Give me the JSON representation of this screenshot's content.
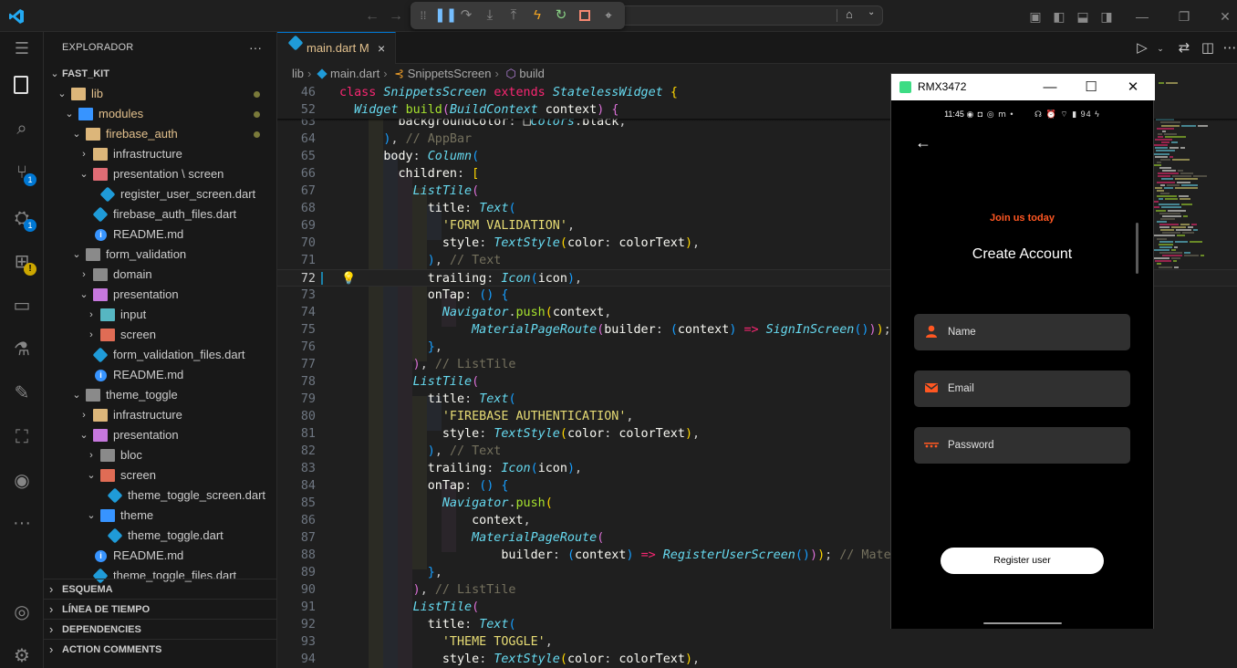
{
  "colors": {
    "accent": "#0078d4",
    "editor_bg": "#1f1f1f",
    "sidebar_bg": "#181818",
    "brand_orange": "#ff5722",
    "modified": "#e2c08d"
  },
  "titlebar": {
    "nav_back": "←",
    "nav_forward": "→",
    "debug_icons": [
      "drag-handle-icon",
      "pause-icon",
      "restart-icon",
      "step-over-icon",
      "step-into-icon",
      "hot-reload-icon",
      "hot-restart-icon",
      "stop-icon",
      "inspect-icon"
    ]
  },
  "activity": {
    "source_control_badge": "1",
    "debug_badge": "1"
  },
  "sidebar": {
    "title": "EXPLORADOR",
    "more": "···",
    "tree": [
      {
        "label": "FAST_KIT",
        "depth": 0,
        "kind": "root",
        "expanded": true
      },
      {
        "label": "lib",
        "depth": 1,
        "kind": "folder",
        "expanded": true,
        "color": "#dcb67a",
        "modified": true
      },
      {
        "label": "modules",
        "depth": 2,
        "kind": "folder",
        "expanded": true,
        "color": "#3794ff",
        "modified": true
      },
      {
        "label": "firebase_auth",
        "depth": 3,
        "kind": "folder",
        "expanded": true,
        "color": "#dcb67a",
        "modified": true
      },
      {
        "label": "infrastructure",
        "depth": 4,
        "kind": "folder",
        "expanded": false,
        "color": "#dcb67a"
      },
      {
        "label": "presentation \\ screen",
        "depth": 4,
        "kind": "folder",
        "expanded": true,
        "color": "#e06c75"
      },
      {
        "label": "register_user_screen.dart",
        "depth": 5,
        "kind": "dart"
      },
      {
        "label": "firebase_auth_files.dart",
        "depth": 4,
        "kind": "dart"
      },
      {
        "label": "README.md",
        "depth": 4,
        "kind": "info"
      },
      {
        "label": "form_validation",
        "depth": 3,
        "kind": "folder",
        "expanded": true,
        "color": "#8a8a8a"
      },
      {
        "label": "domain",
        "depth": 4,
        "kind": "folder",
        "expanded": false,
        "color": "#8a8a8a"
      },
      {
        "label": "presentation",
        "depth": 4,
        "kind": "folder",
        "expanded": true,
        "color": "#c678dd"
      },
      {
        "label": "input",
        "depth": 5,
        "kind": "folder",
        "expanded": false,
        "color": "#56b6c2"
      },
      {
        "label": "screen",
        "depth": 5,
        "kind": "folder",
        "expanded": false,
        "color": "#e06c55"
      },
      {
        "label": "form_validation_files.dart",
        "depth": 4,
        "kind": "dart"
      },
      {
        "label": "README.md",
        "depth": 4,
        "kind": "info"
      },
      {
        "label": "theme_toggle",
        "depth": 3,
        "kind": "folder",
        "expanded": true,
        "color": "#8a8a8a"
      },
      {
        "label": "infrastructure",
        "depth": 4,
        "kind": "folder",
        "expanded": false,
        "color": "#dcb67a"
      },
      {
        "label": "presentation",
        "depth": 4,
        "kind": "folder",
        "expanded": true,
        "color": "#c678dd"
      },
      {
        "label": "bloc",
        "depth": 5,
        "kind": "folder",
        "expanded": false,
        "color": "#8a8a8a"
      },
      {
        "label": "screen",
        "depth": 5,
        "kind": "folder",
        "expanded": true,
        "color": "#e06c55"
      },
      {
        "label": "theme_toggle_screen.dart",
        "depth": 6,
        "kind": "dart"
      },
      {
        "label": "theme",
        "depth": 5,
        "kind": "folder",
        "expanded": true,
        "color": "#3794ff"
      },
      {
        "label": "theme_toggle.dart",
        "depth": 6,
        "kind": "dart"
      },
      {
        "label": "README.md",
        "depth": 4,
        "kind": "info"
      },
      {
        "label": "theme_toggle_files.dart",
        "depth": 4,
        "kind": "dart"
      }
    ],
    "sections": [
      "ESQUEMA",
      "LÍNEA DE TIEMPO",
      "DEPENDENCIES",
      "ACTION COMMENTS"
    ]
  },
  "editor": {
    "tab": {
      "label": "main.dart",
      "status": "M",
      "close": "×"
    },
    "breadcrumb": [
      "lib",
      "main.dart",
      "SnippetsScreen",
      "build"
    ],
    "sticky": [
      {
        "num": "46",
        "html": "<span class='kw'>class</span> <span class='cls'>SnippetsScreen</span> <span class='kw'>extends</span> <span class='cls'>StatelessWidget</span> <span class='p1'>{</span>"
      },
      {
        "num": "52",
        "html": "  <span class='cls'>Widget</span> <span class='fn'>build</span><span class='p2'>(</span><span class='cls'>BuildContext</span> <span class='id'>context</span><span class='p2'>)</span> <span class='p2'>{</span>"
      }
    ],
    "lines": [
      {
        "num": "63",
        "html": "        <span class='prop'>backgroundColor</span>: <span class='id'>&#9633;</span><span class='cls'>Colors</span>.<span class='id'>black</span>,"
      },
      {
        "num": "64",
        "html": "      <span class='p3'>)</span>, <span class='cmt'>// AppBar</span>"
      },
      {
        "num": "65",
        "html": "      <span class='prop'>body</span>: <span class='cls'>Column</span><span class='p3'>(</span>"
      },
      {
        "num": "66",
        "html": "        <span class='prop'>children</span>: <span class='p1'>[</span>"
      },
      {
        "num": "67",
        "html": "          <span class='cls'>ListTile</span><span class='p2'>(</span>"
      },
      {
        "num": "68",
        "html": "            <span class='prop'>title</span>: <span class='cls'>Text</span><span class='p3'>(</span>"
      },
      {
        "num": "69",
        "html": "              <span class='str'>'FORM VALIDATION'</span>,"
      },
      {
        "num": "70",
        "html": "              <span class='prop'>style</span>: <span class='cls'>TextStyle</span><span class='p1'>(</span><span class='prop'>color</span>: <span class='id'>colorText</span><span class='p1'>)</span>,"
      },
      {
        "num": "71",
        "html": "            <span class='p3'>)</span>, <span class='cmt'>// Text</span>"
      },
      {
        "num": "72",
        "html": "            <span class='prop'>trailing</span>: <span class='cls'>Icon</span><span class='p3'>(</span><span class='id'>icon</span><span class='p3'>)</span>,",
        "current": true
      },
      {
        "num": "73",
        "html": "            <span class='prop'>onTap</span>: <span class='p3'>()</span> <span class='p3'>{</span>"
      },
      {
        "num": "74",
        "html": "              <span class='cls'>Navigator</span>.<span class='fn'>push</span><span class='p1'>(</span><span class='id'>context</span>,"
      },
      {
        "num": "75",
        "html": "                  <span class='cls'>MaterialPageRoute</span><span class='p2'>(</span><span class='prop'>builder</span>: <span class='p3'>(</span><span class='id'>context</span><span class='p3'>)</span> <span class='arrow'>=&gt;</span> <span class='cls'>SignInScreen</span><span class='p3'>()</span><span class='p2'>)</span><span class='p1'>)</span>;"
      },
      {
        "num": "76",
        "html": "            <span class='p3'>}</span>,"
      },
      {
        "num": "77",
        "html": "          <span class='p2'>)</span>, <span class='cmt'>// ListTile</span>"
      },
      {
        "num": "78",
        "html": "          <span class='cls'>ListTile</span><span class='p2'>(</span>"
      },
      {
        "num": "79",
        "html": "            <span class='prop'>title</span>: <span class='cls'>Text</span><span class='p3'>(</span>"
      },
      {
        "num": "80",
        "html": "              <span class='str'>'FIREBASE AUTHENTICATION'</span>,"
      },
      {
        "num": "81",
        "html": "              <span class='prop'>style</span>: <span class='cls'>TextStyle</span><span class='p1'>(</span><span class='prop'>color</span>: <span class='id'>colorText</span><span class='p1'>)</span>,"
      },
      {
        "num": "82",
        "html": "            <span class='p3'>)</span>, <span class='cmt'>// Text</span>"
      },
      {
        "num": "83",
        "html": "            <span class='prop'>trailing</span>: <span class='cls'>Icon</span><span class='p3'>(</span><span class='id'>icon</span><span class='p3'>)</span>,"
      },
      {
        "num": "84",
        "html": "            <span class='prop'>onTap</span>: <span class='p3'>()</span> <span class='p3'>{</span>"
      },
      {
        "num": "85",
        "html": "              <span class='cls'>Navigator</span>.<span class='fn'>push</span><span class='p1'>(</span>"
      },
      {
        "num": "86",
        "html": "                  <span class='id'>context</span>,"
      },
      {
        "num": "87",
        "html": "                  <span class='cls'>MaterialPageRoute</span><span class='p2'>(</span>"
      },
      {
        "num": "88",
        "html": "                      <span class='prop'>builder</span>: <span class='p3'>(</span><span class='id'>context</span><span class='p3'>)</span> <span class='arrow'>=&gt;</span> <span class='cls'>RegisterUserScreen</span><span class='p3'>()</span><span class='p2'>)</span><span class='p1'>)</span>; <span class='cmt'>// Materia</span>"
      },
      {
        "num": "89",
        "html": "            <span class='p3'>}</span>,"
      },
      {
        "num": "90",
        "html": "          <span class='p2'>)</span>, <span class='cmt'>// ListTile</span>"
      },
      {
        "num": "91",
        "html": "          <span class='cls'>ListTile</span><span class='p2'>(</span>"
      },
      {
        "num": "92",
        "html": "            <span class='prop'>title</span>: <span class='cls'>Text</span><span class='p3'>(</span>"
      },
      {
        "num": "93",
        "html": "              <span class='str'>'THEME TOGGLE'</span>,"
      },
      {
        "num": "94",
        "html": "              <span class='prop'>style</span>: <span class='cls'>TextStyle</span><span class='p1'>(</span><span class='prop'>color</span>: <span class='id'>colorText</span><span class='p1'>)</span>,"
      }
    ]
  },
  "emulator": {
    "title": "RMX3472",
    "status_time": "11:45",
    "status_icons": "◉ ◘ ◎ ⅿ •",
    "status_right": "☊ ⏰ ⌔ ▮ 94 ϟ",
    "join_text": "Join us today",
    "heading": "Create Account",
    "fields": [
      {
        "icon": "person-icon",
        "glyph": "●",
        "placeholder": "Name"
      },
      {
        "icon": "email-icon",
        "glyph": "✉",
        "placeholder": "Email"
      },
      {
        "icon": "password-icon",
        "glyph": "•••",
        "placeholder": "Password"
      }
    ],
    "button": "Register user"
  }
}
